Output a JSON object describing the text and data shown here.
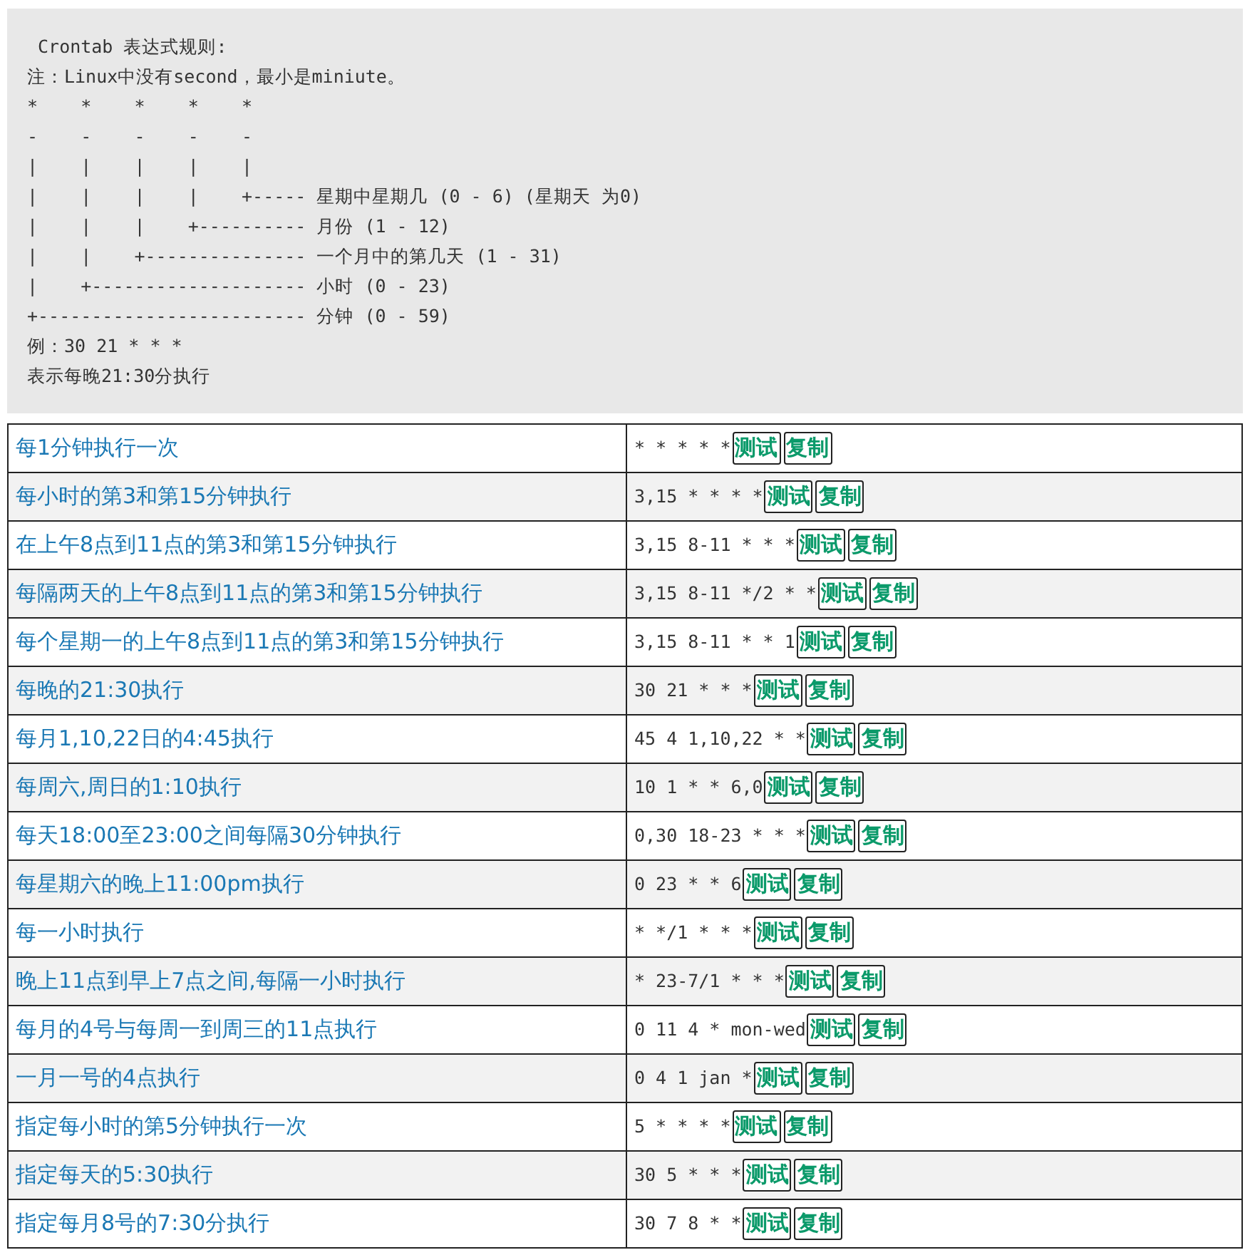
{
  "rules_block": {
    "lines": [
      " Crontab 表达式规则:",
      "注：Linux中没有second，最小是miniute。",
      "*    *    *    *    *",
      "-    -    -    -    -",
      "|    |    |    |    |",
      "|    |    |    |    +----- 星期中星期几 (0 - 6) (星期天 为0)",
      "|    |    |    +---------- 月份 (1 - 12)",
      "|    |    +--------------- 一个月中的第几天 (1 - 31)",
      "|    +-------------------- 小时 (0 - 23)",
      "+------------------------- 分钟 (0 - 59)",
      "例：30 21 * * *",
      "表示每晚21:30分执行"
    ]
  },
  "table": {
    "rows": [
      {
        "description": "每1分钟执行一次",
        "expression": "* * * * *",
        "buttons": [
          "测试",
          "复制"
        ]
      },
      {
        "description": "每小时的第3和第15分钟执行",
        "expression": "3,15 * * * *",
        "buttons": [
          "测试",
          "复制"
        ]
      },
      {
        "description": "在上午8点到11点的第3和第15分钟执行",
        "expression": "3,15 8-11 * * *",
        "buttons": [
          "测试",
          "复制"
        ]
      },
      {
        "description": "每隔两天的上午8点到11点的第3和第15分钟执行",
        "expression": "3,15 8-11 */2 * *",
        "buttons": [
          "测试",
          "复制"
        ]
      },
      {
        "description": "每个星期一的上午8点到11点的第3和第15分钟执行",
        "expression": "3,15 8-11 * * 1",
        "buttons": [
          "测试",
          "复制"
        ]
      },
      {
        "description": "每晚的21:30执行",
        "expression": "30 21 * * *",
        "buttons": [
          "测试",
          "复制"
        ]
      },
      {
        "description": "每月1,10,22日的4:45执行",
        "expression": "45 4 1,10,22 * *",
        "buttons": [
          "测试",
          "复制"
        ]
      },
      {
        "description": "每周六,周日的1:10执行",
        "expression": "10 1 * * 6,0",
        "buttons": [
          "测试",
          "复制"
        ]
      },
      {
        "description": "每天18:00至23:00之间每隔30分钟执行",
        "expression": "0,30 18-23 * * *",
        "buttons": [
          "测试",
          "复制"
        ]
      },
      {
        "description": "每星期六的晚上11:00pm执行",
        "expression": "0 23 * * 6",
        "buttons": [
          "测试",
          "复制"
        ]
      },
      {
        "description": "每一小时执行",
        "expression": "* */1 * * *",
        "buttons": [
          "测试",
          "复制"
        ]
      },
      {
        "description": "晚上11点到早上7点之间,每隔一小时执行",
        "expression": "* 23-7/1 * * *",
        "buttons": [
          "测试",
          "复制"
        ]
      },
      {
        "description": "每月的4号与每周一到周三的11点执行",
        "expression": "0 11 4 * mon-wed",
        "buttons": [
          "测试",
          "复制"
        ]
      },
      {
        "description": "一月一号的4点执行",
        "expression": "0 4 1 jan *",
        "buttons": [
          "测试",
          "复制"
        ]
      },
      {
        "description": "指定每小时的第5分钟执行一次",
        "expression": "5 * * * *",
        "buttons": [
          "测试",
          "复制"
        ]
      },
      {
        "description": "指定每天的5:30执行",
        "expression": "30 5 * * *",
        "buttons": [
          "测试",
          "复制"
        ]
      },
      {
        "description": "指定每月8号的7:30分执行",
        "expression": "30 7 8 * *",
        "buttons": [
          "测试",
          "复制"
        ]
      }
    ]
  }
}
